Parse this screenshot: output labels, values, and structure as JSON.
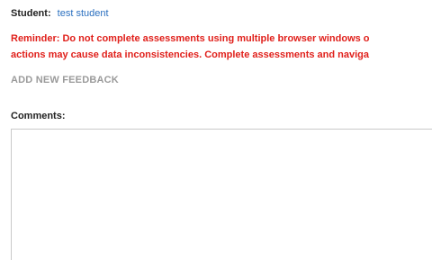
{
  "student": {
    "label": "Student:",
    "name": "test student"
  },
  "reminder": {
    "line1": "Reminder: Do not complete assessments using multiple browser windows o",
    "line2": "actions may cause data inconsistencies. Complete assessments and naviga"
  },
  "actions": {
    "add_feedback_label": "ADD NEW FEEDBACK"
  },
  "comments": {
    "label": "Comments:",
    "value": ""
  },
  "colors": {
    "link": "#2a6fbf",
    "warning": "#e0201b",
    "muted_action": "#9a9a9a"
  }
}
